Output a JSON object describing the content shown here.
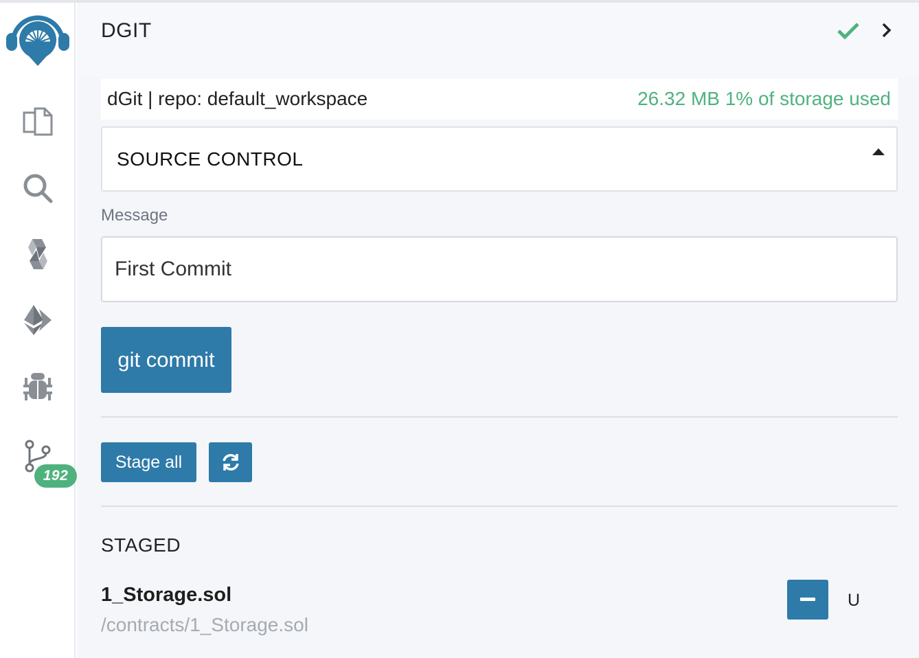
{
  "rail": {
    "items": [
      {
        "icon": "remix-logo-icon"
      },
      {
        "icon": "file-explorer-icon"
      },
      {
        "icon": "search-icon"
      },
      {
        "icon": "solidity-compiler-icon"
      },
      {
        "icon": "deploy-run-icon"
      },
      {
        "icon": "debugger-icon"
      },
      {
        "icon": "git-branch-icon",
        "badge": "192"
      }
    ]
  },
  "header": {
    "title": "DGIT",
    "status_icon": "check-icon",
    "status_color": "#4fb27e"
  },
  "repo": {
    "name": "dGit | repo: default_workspace",
    "storage": "26.32 MB 1% of storage used"
  },
  "source_control": {
    "title": "SOURCE CONTROL"
  },
  "commit": {
    "message_label": "Message",
    "message_value": "First Commit",
    "button_label": "git commit"
  },
  "actions": {
    "stage_all_label": "Stage all"
  },
  "staged": {
    "title": "STAGED",
    "files": [
      {
        "name": "1_Storage.sol",
        "path": "/contracts/1_Storage.sol",
        "status": "U"
      }
    ]
  },
  "colors": {
    "accent": "#2e7aa8",
    "success": "#4fb27e",
    "muted": "#a5abb3"
  }
}
